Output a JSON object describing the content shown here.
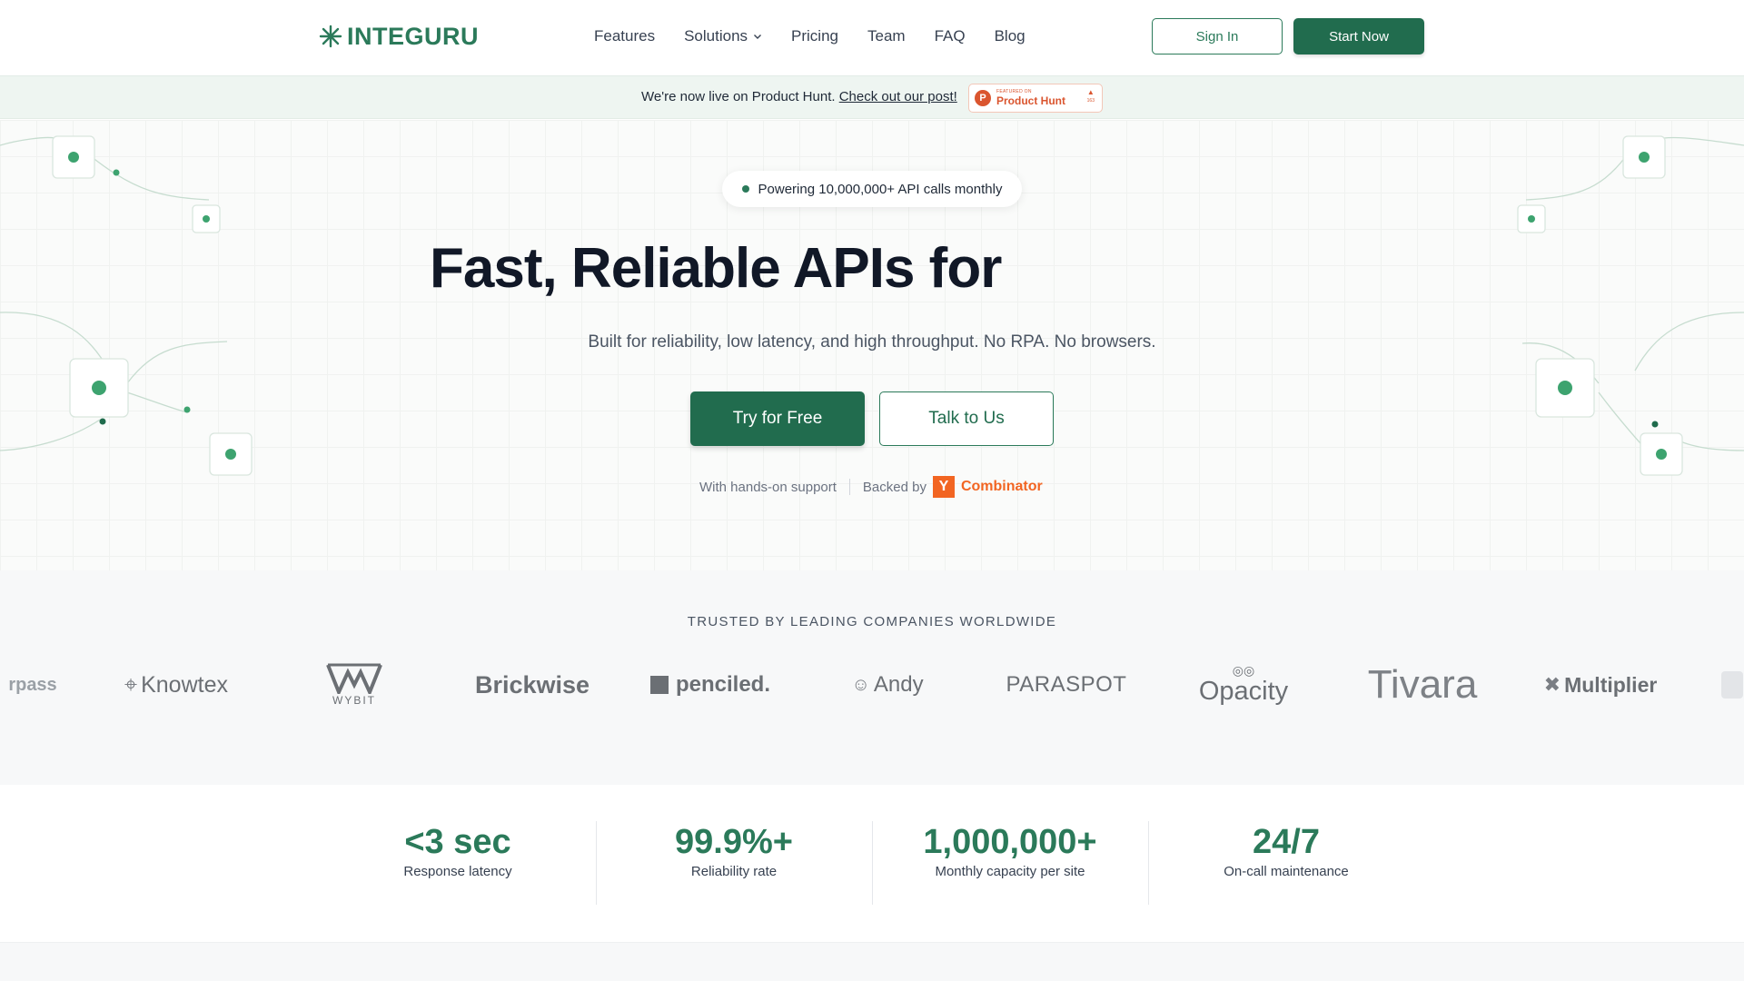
{
  "brand": {
    "name": "INTEGURU",
    "accent": "#2b7a5a",
    "dark_accent": "#216c4e"
  },
  "nav": {
    "links": [
      "Features",
      "Solutions",
      "Pricing",
      "Team",
      "FAQ",
      "Blog"
    ],
    "sign_in": "Sign In",
    "start_now": "Start Now"
  },
  "announcement": {
    "text": "We're now live on Product Hunt.",
    "link": "Check out our post!",
    "badge": {
      "small": "FEATURED ON",
      "name": "Product Hunt",
      "count": "163",
      "icon": "product-hunt-icon",
      "color": "#da552f"
    }
  },
  "hero": {
    "pill": "Powering 10,000,000+ API calls monthly",
    "title": "Fast, Reliable APIs for",
    "subtitle": "Built for reliability, low latency, and high throughput. No RPA. No browsers.",
    "try_button": "Try for Free",
    "talk_button": "Talk to Us",
    "support_text": "With hands-on support",
    "backed_by": "Backed by",
    "yc_letter": "Y",
    "yc_name": "Combinator"
  },
  "trusted": {
    "title": "TRUSTED BY LEADING COMPANIES WORLDWIDE",
    "logos": [
      "rpass",
      "Knowtex",
      "WYBIT",
      "Brickwise",
      "penciled.",
      "Andy",
      "PARASPOT",
      "Opacity",
      "Tivara",
      "Multiplier"
    ]
  },
  "stats": [
    {
      "value": "<3 sec",
      "label": "Response latency"
    },
    {
      "value": "99.9%+",
      "label": "Reliability rate"
    },
    {
      "value": "1,000,000+",
      "label": "Monthly capacity per site"
    },
    {
      "value": "24/7",
      "label": "On-call maintenance"
    }
  ]
}
